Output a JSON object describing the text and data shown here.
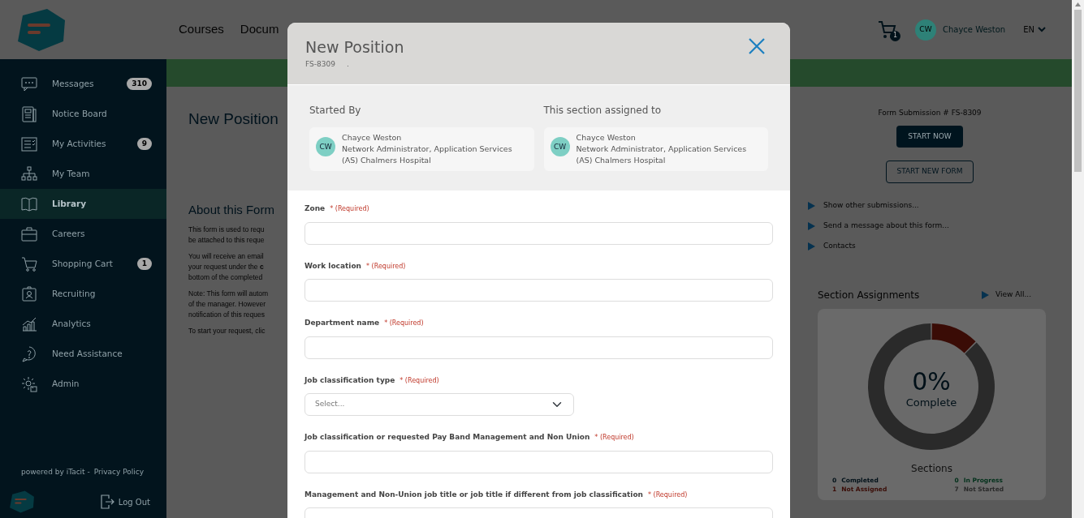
{
  "topbar": {
    "nav": [
      {
        "label": "Courses"
      },
      {
        "label": "Docum"
      }
    ],
    "cart_count": "1",
    "user": {
      "initials": "CW",
      "name": "Chayce Weston"
    },
    "language": "EN"
  },
  "sidebar": {
    "items": [
      {
        "label": "Messages",
        "badge": "310",
        "selected": false
      },
      {
        "label": "Notice Board",
        "selected": false
      },
      {
        "label": "My Activities",
        "badge": "9",
        "selected": false
      },
      {
        "label": "My Team",
        "selected": false
      },
      {
        "label": "Library",
        "selected": true
      },
      {
        "label": "Careers",
        "selected": false
      },
      {
        "label": "Shopping Cart",
        "badge": "1",
        "selected": false
      },
      {
        "label": "Recruiting",
        "selected": false
      },
      {
        "label": "Analytics",
        "selected": false
      },
      {
        "label": "Need Assistance",
        "selected": false
      },
      {
        "label": "Admin",
        "selected": false
      }
    ],
    "powered_by": "powered by iTacit -",
    "privacy": "Privacy Policy",
    "logout": "Log Out"
  },
  "page": {
    "title": "New Position",
    "about_title": "About this Form",
    "about_paragraphs": [
      [
        "This form is used to requ",
        "be attached to this reque"
      ],
      [
        "You will receive an email",
        "your request under the **c**",
        "bottom of the completed"
      ],
      [
        "Note: This form will autom",
        "of the manager. However",
        "notification of this reques"
      ],
      [
        "To start your request, clic"
      ]
    ],
    "submission": "Form Submission # FS-8309",
    "start_now": "START NOW",
    "start_new": "START NEW FORM",
    "links": [
      "Show other submissions...",
      "Send a message about this form...",
      "Contacts"
    ],
    "assignments": {
      "title": "Section Assignments",
      "view_all": "View All...",
      "percent": "0%",
      "complete": "Complete",
      "sections_title": "Sections",
      "legend": [
        {
          "count": "0",
          "label": "Completed",
          "color": "#001018"
        },
        {
          "count": "0",
          "label": "In Progress",
          "color": "#00301a"
        },
        {
          "count": "1",
          "label": "Not Assigned",
          "color": "#3a0c06"
        },
        {
          "count": "7",
          "label": "Not Started",
          "color": "#2a2a2a"
        }
      ]
    }
  },
  "modal": {
    "title": "New Position",
    "code": "FS-8309",
    "dot": ".",
    "started_by": {
      "heading": "Started By",
      "initials": "CW",
      "name": "Chayce Weston",
      "role": "Network Administrator, Application Services",
      "org": "(AS) Chalmers Hospital"
    },
    "assigned_to": {
      "heading": "This section assigned to",
      "initials": "CW",
      "name": "Chayce Weston",
      "role": "Network Administrator, Application Services",
      "org": "(AS) Chalmers Hospital"
    },
    "fields": [
      {
        "kind": "text",
        "label": "Zone",
        "required": "* (Required)"
      },
      {
        "kind": "text",
        "label": "Work location",
        "required": "* (Required)"
      },
      {
        "kind": "text",
        "label": "Department name",
        "required": "* (Required)"
      },
      {
        "kind": "select",
        "label": "Job classification type",
        "required": "* (Required)",
        "placeholder": "Select..."
      },
      {
        "kind": "text",
        "label": "Job classification or requested Pay Band Management and Non Union",
        "required": "* (Required)"
      },
      {
        "kind": "text",
        "label": "Management and Non-Union job title or job title if different from job classification",
        "required": "* (Required)"
      }
    ]
  }
}
